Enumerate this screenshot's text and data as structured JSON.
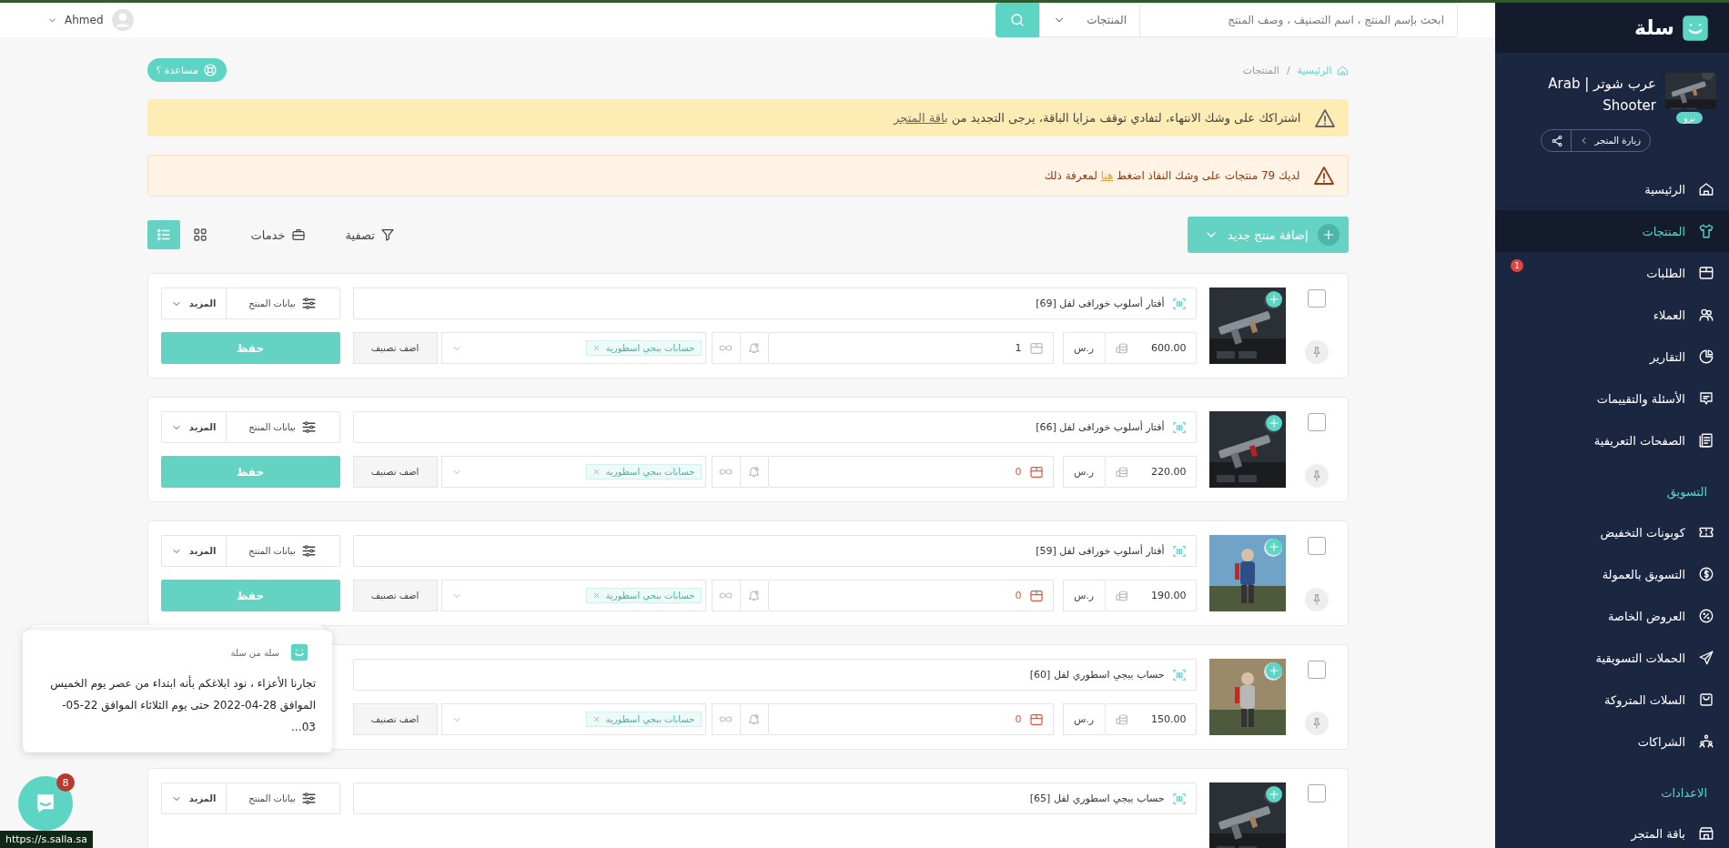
{
  "topbar": {
    "user": "Ahmed",
    "search": {
      "placeholder": "ابحث بإسم المنتج ، اسم التصنيف ، وصف المنتج",
      "scope": "المنتجات"
    }
  },
  "sidebar": {
    "brand": "سلة",
    "store": {
      "name": "عرب شوتر | Arab Shooter",
      "plan": "برو",
      "visit": "زيارة المتجر"
    },
    "sections": [
      {
        "items": [
          {
            "label": "الرئيسية",
            "selected": false
          },
          {
            "label": "المنتجات",
            "selected": true
          },
          {
            "label": "الطلبات",
            "selected": false,
            "badge": "1"
          },
          {
            "label": "العملاء",
            "selected": false
          },
          {
            "label": "التقارير",
            "selected": false
          },
          {
            "label": "الأسئلة والتقييمات",
            "selected": false
          },
          {
            "label": "الصفحات التعريفية",
            "selected": false
          }
        ]
      },
      {
        "heading": "التسويق",
        "items": [
          {
            "label": "كوبونات التخفيض",
            "selected": false
          },
          {
            "label": "التسويق بالعمولة",
            "selected": false
          },
          {
            "label": "العروض الخاصة",
            "selected": false
          },
          {
            "label": "الحملات التسويقية",
            "selected": false
          },
          {
            "label": "السلات المتروكة",
            "selected": false
          },
          {
            "label": "الشراكات",
            "selected": false
          }
        ]
      },
      {
        "heading": "الاعدادات",
        "items": [
          {
            "label": "باقة المتجر",
            "selected": false
          }
        ]
      }
    ]
  },
  "breadcrumb": [
    {
      "label": "الرئيسية"
    },
    {
      "label": "المنتجات"
    }
  ],
  "breadcrumb_separator": "/",
  "help": "مساعدة ؟",
  "alerts": [
    {
      "kind": "warning",
      "text": "اشتراكك على وشك الانتهاء، لتفادي توقف مزايا الباقة، يرجى التجديد من ",
      "link": "باقة المتجر"
    },
    {
      "kind": "danger",
      "text": "لديك 79 منتجات على وشك النفاذ اضغط ",
      "link": "هنا",
      "text_after": " لمعرفة ذلك"
    }
  ],
  "toolbar": {
    "add_button": "إضافة منتج جديد",
    "filter": "تصفية",
    "services": "خدمات",
    "views": [
      {
        "selected": false
      },
      {
        "selected": true
      }
    ]
  },
  "products": [
    {
      "name": "أفتار أسلوب خورافى لفل [69]",
      "checked": false,
      "price": "600.00",
      "currency": "ر.س",
      "stock": "1",
      "stock_alert": false,
      "category": "حسابات ببجي اسطورية",
      "add_category": "اضف تصنيف",
      "details": "بيانات المنتج",
      "more": "المزيد",
      "save": "حفظ"
    },
    {
      "name": "أفتار أسلوب خورافى لفل [66]",
      "checked": false,
      "price": "220.00",
      "currency": "ر.س",
      "stock": "0",
      "stock_alert": true,
      "category": "حسابات ببجي اسطورية",
      "add_category": "اضف تصنيف",
      "details": "بيانات المنتج",
      "more": "المزيد",
      "save": "حفظ"
    },
    {
      "name": "أفتار أسلوب خورافى لفل [59]",
      "checked": false,
      "price": "190.00",
      "currency": "ر.س",
      "stock": "0",
      "stock_alert": true,
      "category": "حسابات ببجي اسطورية",
      "add_category": "اضف تصنيف",
      "details": "بيانات المنتج",
      "more": "المزيد",
      "save": "حفظ"
    },
    {
      "name": "حساب ببجي اسطوري لفل [60]",
      "checked": false,
      "price": "150.00",
      "currency": "ر.س",
      "stock": "0",
      "stock_alert": true,
      "category": "حسابات ببجي اسطورية",
      "add_category": "اضف تصنيف"
    },
    {
      "name": "حساب ببجي اسطوري لفل [65]",
      "checked": false,
      "details": "بيانات المنتج",
      "more": "المزيد"
    }
  ],
  "chat": {
    "sender": "سلة من سلة",
    "message": "تجارنا الأعزاء ،  نود ابلاغكم بأنه ابتداء من عصر يوم الخميس الموافق  28-04-2022 حتى يوم الثلاثاء الموافق 22-05-03…",
    "unread": "8"
  },
  "status_url": "https://s.salla.sa"
}
